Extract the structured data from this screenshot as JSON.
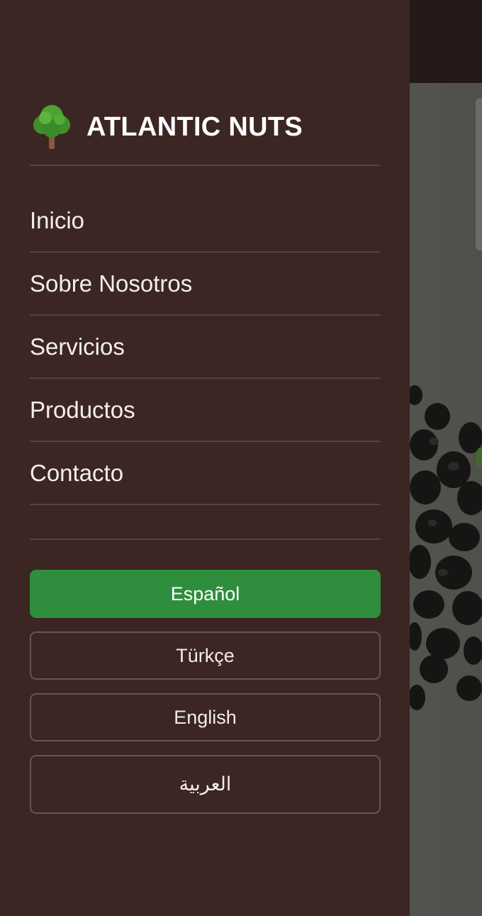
{
  "brand": {
    "name": "ATLANTIC NUTS",
    "icon": "tree-icon"
  },
  "nav": {
    "items": [
      {
        "label": "Inicio"
      },
      {
        "label": "Sobre Nosotros"
      },
      {
        "label": "Servicios"
      },
      {
        "label": "Productos"
      },
      {
        "label": "Contacto"
      }
    ]
  },
  "languages": {
    "selected": "Español",
    "options": [
      {
        "label": "Español",
        "active": true
      },
      {
        "label": "Türkçe",
        "active": false
      },
      {
        "label": "English",
        "active": false
      },
      {
        "label": "العربية",
        "active": false
      }
    ]
  },
  "colors": {
    "drawer_bg": "#3b2623",
    "active_lang": "#2f8e3e",
    "divider": "#574240"
  }
}
